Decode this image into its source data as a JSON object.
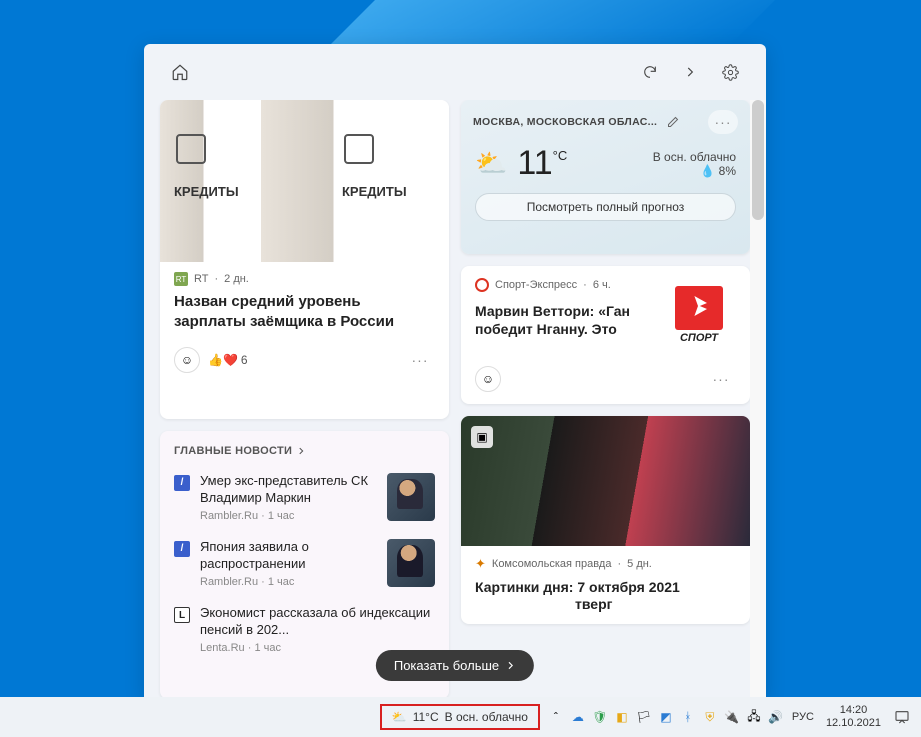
{
  "header": {
    "home": "home-icon",
    "refresh": "refresh-icon",
    "forward": "forward-icon",
    "settings": "gear-icon"
  },
  "news1": {
    "kredit_label": "КРЕДИТЫ",
    "source": "RT",
    "time": "2 дн.",
    "title": "Назван средний уровень зарплаты заёмщика в России",
    "reactions": "6"
  },
  "weather": {
    "location": "МОСКВА, МОСКОВСКАЯ ОБЛАС...",
    "temp": "11",
    "unit": "°C",
    "condition": "В осн. облачно",
    "precip": "8%",
    "forecast_btn": "Посмотреть полный прогноз"
  },
  "sport": {
    "source": "Спорт-Экспресс",
    "time": "6 ч.",
    "title": "Марвин Веттори: «Ган победит Нганну. Это",
    "logo_text": "СПОРТ"
  },
  "headlines": {
    "header": "ГЛАВНЫЕ НОВОСТИ",
    "items": [
      {
        "title": "Умер экс-представитель СК Владимир Маркин",
        "source": "Rambler.Ru",
        "time": "1 час"
      },
      {
        "title": "Япония заявила о распространении",
        "source": "Rambler.Ru",
        "time": "1 час"
      },
      {
        "title": "Экономист рассказала об индексации пенсий в 202...",
        "source": "Lenta.Ru",
        "time": "1 час"
      }
    ]
  },
  "imgcard": {
    "source": "Комсомольская правда",
    "time": "5 дн.",
    "title": "Картинки дня: 7 октября 2021",
    "subtitle": "тверг"
  },
  "show_more": "Показать больше",
  "taskbar": {
    "weather_temp": "11°C",
    "weather_cond": "В осн. облачно",
    "lang": "РУС",
    "time": "14:20",
    "date": "12.10.2021"
  }
}
